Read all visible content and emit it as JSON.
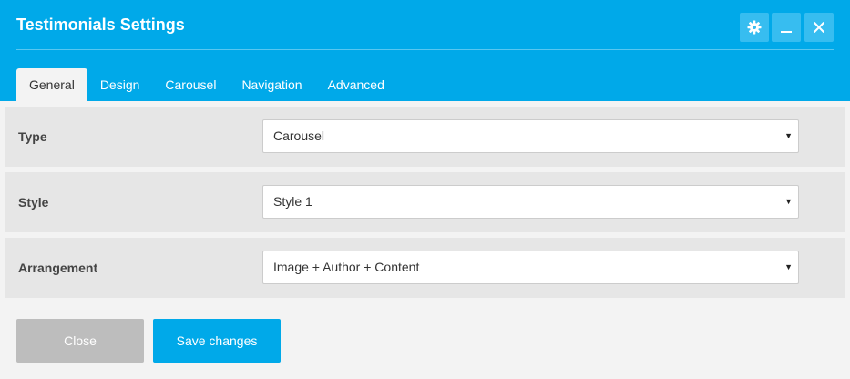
{
  "window": {
    "title": "Testimonials Settings"
  },
  "header_buttons": [
    {
      "icon": "gear-icon"
    },
    {
      "icon": "minimize-icon"
    },
    {
      "icon": "close-icon"
    }
  ],
  "tabs": [
    {
      "label": "General",
      "active": true
    },
    {
      "label": "Design",
      "active": false
    },
    {
      "label": "Carousel",
      "active": false
    },
    {
      "label": "Navigation",
      "active": false
    },
    {
      "label": "Advanced",
      "active": false
    }
  ],
  "fields": [
    {
      "label": "Type",
      "value": "Carousel"
    },
    {
      "label": "Style",
      "value": "Style 1"
    },
    {
      "label": "Arrangement",
      "value": "Image + Author + Content"
    }
  ],
  "footer": {
    "close_label": "Close",
    "save_label": "Save changes"
  },
  "colors": {
    "accent": "#00a9e9",
    "header_button_bg": "#37bdf0",
    "disabled_button": "#bdbdbd",
    "row_bg": "#e6e6e6",
    "panel_bg": "#f3f3f3"
  }
}
